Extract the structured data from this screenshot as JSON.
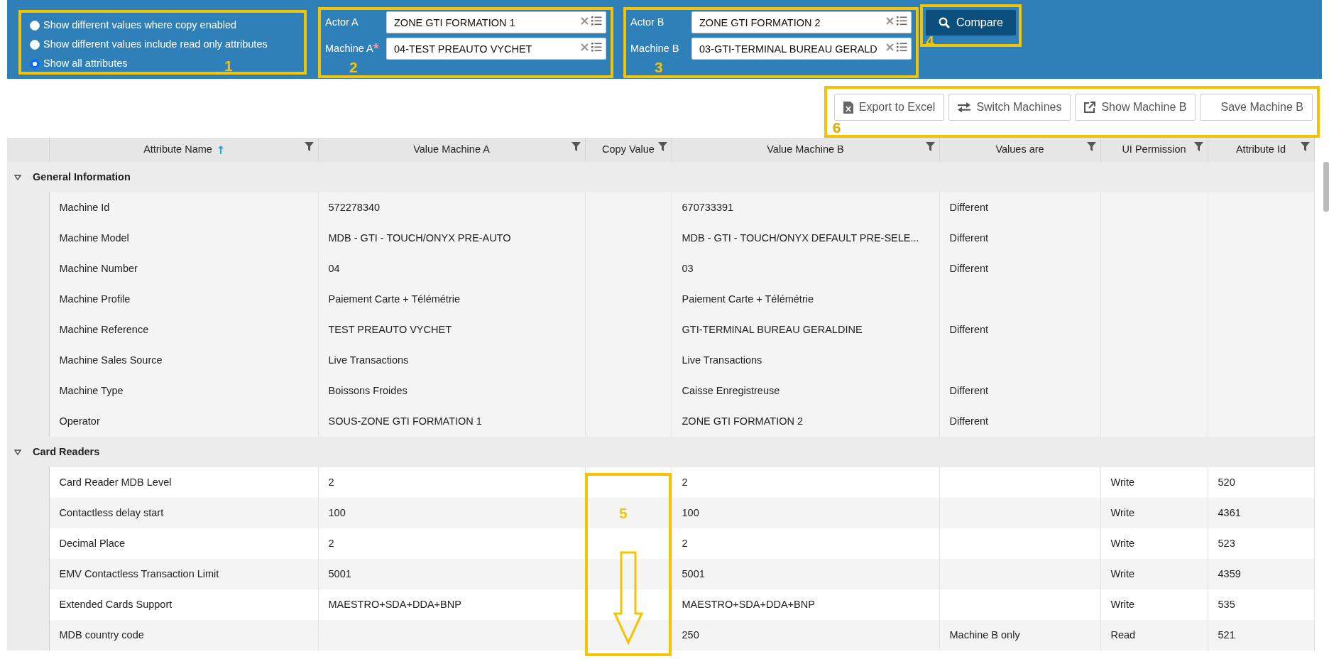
{
  "filter_options": [
    {
      "label": "Show different values where copy enabled",
      "selected": false
    },
    {
      "label": "Show different values include read only attributes",
      "selected": false
    },
    {
      "label": "Show all attributes",
      "selected": true
    }
  ],
  "machine_a": {
    "actor_label": "Actor A",
    "actor_value": "ZONE GTI FORMATION 1",
    "machine_label": "Machine A",
    "required_mark": "*",
    "machine_value": "04-TEST PREAUTO VYCHET"
  },
  "machine_b": {
    "actor_label": "Actor B",
    "actor_value": "ZONE GTI FORMATION 2",
    "machine_label": "Machine B",
    "machine_value": "03-GTI-TERMINAL BUREAU GERALD"
  },
  "compare_button": "Compare",
  "toolbar_buttons": [
    {
      "label": "Export to Excel",
      "kind": "excel"
    },
    {
      "label": "Switch Machines",
      "kind": "switch"
    },
    {
      "label": "Show Machine B",
      "kind": "external"
    },
    {
      "label": "Save Machine B",
      "kind": "none"
    }
  ],
  "table": {
    "columns": [
      {
        "label": "Attribute Name",
        "sorted": true
      },
      {
        "label": "Value Machine A",
        "sorted": false
      },
      {
        "label": "Copy Value",
        "sorted": false
      },
      {
        "label": "Value Machine B",
        "sorted": false
      },
      {
        "label": "Values are",
        "sorted": false
      },
      {
        "label": "UI Permission",
        "sorted": false
      },
      {
        "label": "Attribute Id",
        "sorted": false
      }
    ],
    "groups": [
      {
        "title": "General Information",
        "expanded": true,
        "rows": [
          [
            "Machine Id",
            "572278340",
            "",
            "670733391",
            "Different",
            "",
            ""
          ],
          [
            "Machine Model",
            "MDB - GTI - TOUCH/ONYX PRE-AUTO",
            "",
            "MDB - GTI - TOUCH/ONYX DEFAULT PRE-SELE...",
            "Different",
            "",
            ""
          ],
          [
            "Machine Number",
            "04",
            "",
            "03",
            "Different",
            "",
            ""
          ],
          [
            "Machine Profile",
            "Paiement Carte + Télémétrie",
            "",
            "Paiement Carte + Télémétrie",
            "",
            "",
            ""
          ],
          [
            "Machine Reference",
            "TEST PREAUTO VYCHET",
            "",
            "GTI-TERMINAL BUREAU GERALDINE",
            "Different",
            "",
            ""
          ],
          [
            "Machine Sales Source",
            "Live Transactions",
            "",
            "Live Transactions",
            "",
            "",
            ""
          ],
          [
            "Machine Type",
            "Boissons Froides",
            "",
            "Caisse Enregistreuse",
            "Different",
            "",
            ""
          ],
          [
            "Operator",
            "SOUS-ZONE GTI FORMATION 1",
            "",
            "ZONE GTI FORMATION 2",
            "Different",
            "",
            ""
          ]
        ]
      },
      {
        "title": "Card Readers",
        "expanded": true,
        "rows": [
          [
            "Card Reader MDB Level",
            "2",
            "",
            "2",
            "",
            "Write",
            "520"
          ],
          [
            "Contactless delay start",
            "100",
            "",
            "100",
            "",
            "Write",
            "4361"
          ],
          [
            "Decimal Place",
            "2",
            "",
            "2",
            "",
            "Write",
            "523"
          ],
          [
            "EMV Contactless Transaction Limit",
            "5001",
            "",
            "5001",
            "",
            "Write",
            "4359"
          ],
          [
            "Extended Cards Support",
            "MAESTRO+SDA+DDA+BNP",
            "",
            "MAESTRO+SDA+DDA+BNP",
            "",
            "Write",
            "535"
          ],
          [
            "MDB country code",
            "",
            "",
            "250",
            "Machine B only",
            "Read",
            "521"
          ]
        ]
      }
    ]
  },
  "annotations": [
    {
      "label": "1"
    },
    {
      "label": "2"
    },
    {
      "label": "3"
    },
    {
      "label": "4"
    },
    {
      "label": "5"
    },
    {
      "label": "6"
    }
  ]
}
